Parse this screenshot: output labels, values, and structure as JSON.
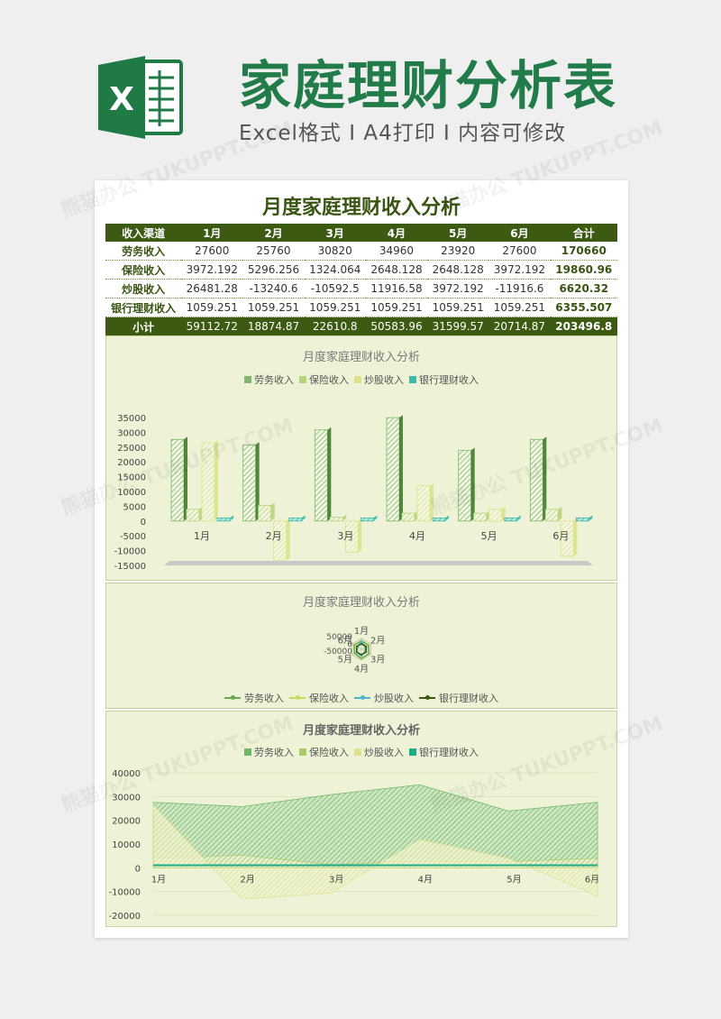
{
  "header": {
    "logo_letter": "X",
    "title": "家庭理财分析表",
    "subtitle": "Excel格式 I A4打印 I 内容可修改"
  },
  "sheet": {
    "title": "月度家庭理财收入分析",
    "columns": [
      "收入渠道",
      "1月",
      "2月",
      "3月",
      "4月",
      "5月",
      "6月",
      "合计"
    ],
    "rows": [
      {
        "name": "劳务收入",
        "values": [
          "27600",
          "25760",
          "30820",
          "34960",
          "23920",
          "27600"
        ],
        "total": "170660"
      },
      {
        "name": "保险收入",
        "values": [
          "3972.192",
          "5296.256",
          "1324.064",
          "2648.128",
          "2648.128",
          "3972.192"
        ],
        "total": "19860.96"
      },
      {
        "name": "炒股收入",
        "values": [
          "26481.28",
          "-13240.6",
          "-10592.5",
          "11916.58",
          "3972.192",
          "-11916.6"
        ],
        "total": "6620.32"
      },
      {
        "name": "银行理财收入",
        "values": [
          "1059.251",
          "1059.251",
          "1059.251",
          "1059.251",
          "1059.251",
          "1059.251"
        ],
        "total": "6355.507"
      }
    ],
    "subtotal": {
      "name": "小计",
      "values": [
        "59112.72",
        "18874.87",
        "22610.8",
        "50583.96",
        "31599.57",
        "20714.87"
      ],
      "total": "203496.8"
    }
  },
  "chart_data": [
    {
      "type": "bar",
      "title": "月度家庭理财收入分析",
      "categories": [
        "1月",
        "2月",
        "3月",
        "4月",
        "5月",
        "6月"
      ],
      "series": [
        {
          "name": "劳务收入",
          "values": [
            27600,
            25760,
            30820,
            34960,
            23920,
            27600
          ]
        },
        {
          "name": "保险收入",
          "values": [
            3972.192,
            5296.256,
            1324.064,
            2648.128,
            2648.128,
            3972.192
          ]
        },
        {
          "name": "炒股收入",
          "values": [
            26481.28,
            -13240.6,
            -10592.5,
            11916.58,
            3972.192,
            -11916.6
          ]
        },
        {
          "name": "银行理财收入",
          "values": [
            1059.251,
            1059.251,
            1059.251,
            1059.251,
            1059.251,
            1059.251
          ]
        }
      ],
      "yticks": [
        "35000",
        "30000",
        "25000",
        "20000",
        "15000",
        "10000",
        "5000",
        "0",
        "-5000",
        "-10000",
        "-15000"
      ],
      "ylim": [
        -15000,
        35000
      ],
      "legend": "top",
      "colors": [
        "#7fb86a",
        "#b8d47a",
        "#dde28a",
        "#3fb8a8"
      ]
    },
    {
      "type": "radar",
      "title": "月度家庭理财收入分析",
      "categories": [
        "1月",
        "2月",
        "3月",
        "4月",
        "5月",
        "6月"
      ],
      "series": [
        {
          "name": "劳务收入",
          "values": [
            27600,
            25760,
            30820,
            34960,
            23920,
            27600
          ]
        },
        {
          "name": "保险收入",
          "values": [
            3972.192,
            5296.256,
            1324.064,
            2648.128,
            2648.128,
            3972.192
          ]
        },
        {
          "name": "炒股收入",
          "values": [
            26481.28,
            -13240.6,
            -10592.5,
            11916.58,
            3972.192,
            -11916.6
          ]
        },
        {
          "name": "银行理财收入",
          "values": [
            1059.251,
            1059.251,
            1059.251,
            1059.251,
            1059.251,
            1059.251
          ]
        }
      ],
      "ticks": [
        "50000",
        "0",
        "-50000"
      ],
      "legend": "bottom",
      "colors": [
        "#6aa84f",
        "#c7d860",
        "#4fb6c8",
        "#3c5a12"
      ]
    },
    {
      "type": "area",
      "title": "月度家庭理财收入分析",
      "categories": [
        "1月",
        "2月",
        "3月",
        "4月",
        "5月",
        "6月"
      ],
      "series": [
        {
          "name": "劳务收入",
          "values": [
            27600,
            25760,
            30820,
            34960,
            23920,
            27600
          ]
        },
        {
          "name": "保险收入",
          "values": [
            3972.192,
            5296.256,
            1324.064,
            2648.128,
            2648.128,
            3972.192
          ]
        },
        {
          "name": "炒股收入",
          "values": [
            26481.28,
            -13240.6,
            -10592.5,
            11916.58,
            3972.192,
            -11916.6
          ]
        },
        {
          "name": "银行理财收入",
          "values": [
            1059.251,
            1059.251,
            1059.251,
            1059.251,
            1059.251,
            1059.251
          ]
        }
      ],
      "yticks": [
        "40000",
        "30000",
        "20000",
        "10000",
        "0",
        "-10000",
        "-20000"
      ],
      "ylim": [
        -20000,
        40000
      ],
      "legend": "top",
      "colors": [
        "#6fb86a",
        "#a8cc6a",
        "#dde28a",
        "#1faa8a"
      ]
    }
  ]
}
